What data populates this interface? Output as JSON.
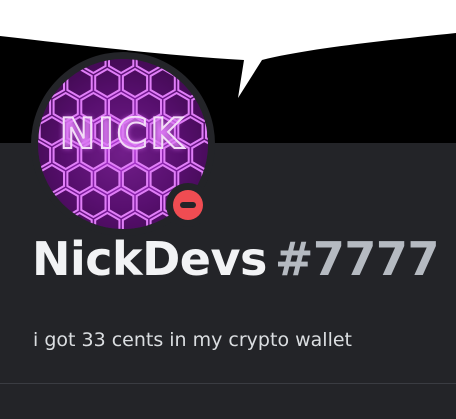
{
  "profile": {
    "avatar_text": "NICK",
    "username": "NickDevs",
    "discriminator": "#7777",
    "bio": "i got 33 cents in my crypto wallet",
    "status": "do-not-disturb"
  },
  "colors": {
    "card_background": "#232428",
    "speech_bubble": "#ffffff",
    "status_dnd": "#f04c52",
    "username": "#f2f3f5",
    "discriminator": "#b5bac1",
    "bio_text": "#dbdee1",
    "avatar_accent": "#b23ad6"
  }
}
